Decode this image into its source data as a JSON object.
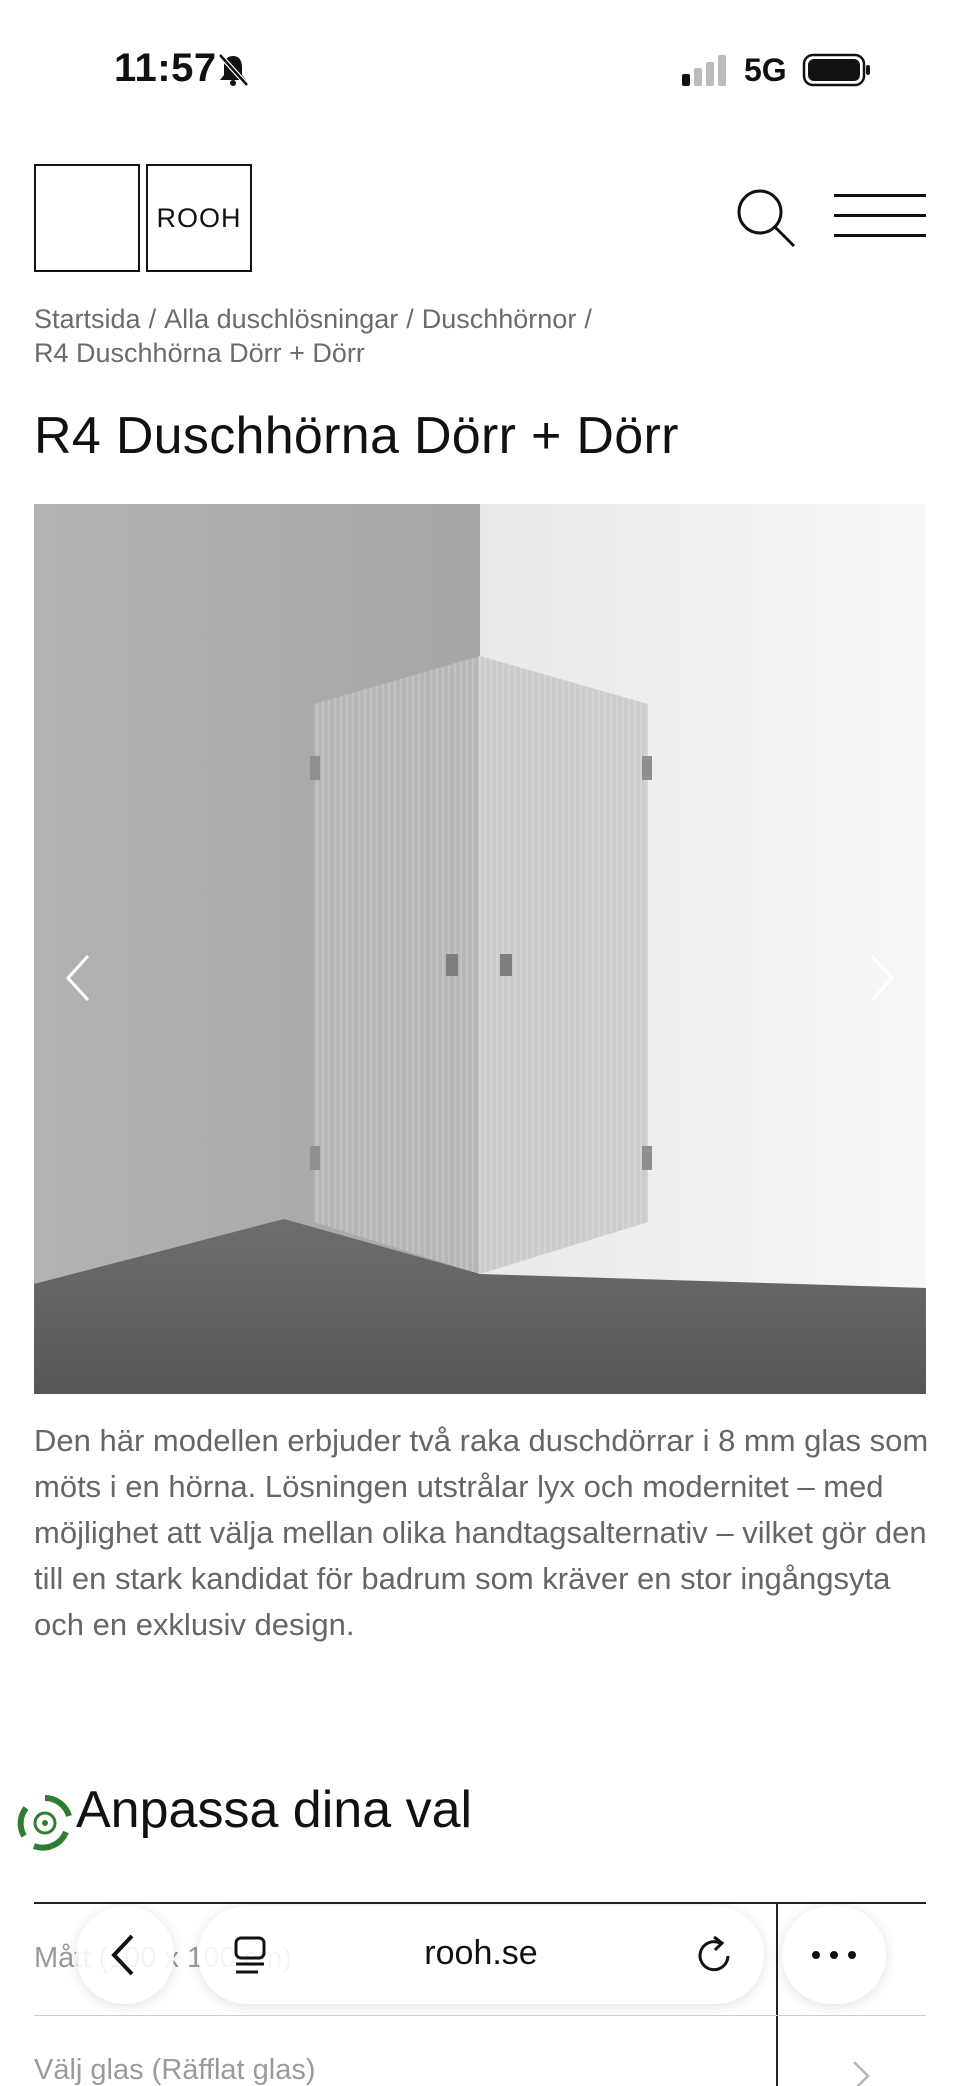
{
  "status_bar": {
    "time": "11:57",
    "network": "5G",
    "icons": [
      "bell-muted-icon",
      "signal-icon",
      "battery-icon"
    ]
  },
  "header": {
    "logo_text": "ROOH",
    "icons": [
      "search-icon",
      "menu-icon"
    ]
  },
  "breadcrumb": {
    "items": [
      "Startsida",
      "Alla duschlösningar",
      "Duschhörnor",
      "R4 Duschhörna Dörr + Dörr"
    ],
    "separator": "/"
  },
  "product": {
    "title": "R4 Duschhörna Dörr + Dörr",
    "description": "Den här modellen erbjuder två raka duschdörrar i 8 mm glas som möts i en hörna. Lösningen utstrålar lyx och modernitet – med möjlighet att välja mellan olika handtagsalternativ – vilket gör den till en stark kandidat för badrum som kräver en stor ingångsyta och en exklusiv design.",
    "gallery_icons": [
      "chevron-left-icon",
      "chevron-right-icon"
    ]
  },
  "customize": {
    "heading": "Anpassa dina val",
    "options": [
      {
        "label": "Mått (100 x 100 cm)"
      },
      {
        "label": "Välj glas (Räfflat glas)"
      }
    ]
  },
  "browser": {
    "url": "rooh.se",
    "icons": [
      "back-icon",
      "tabs-icon",
      "reload-icon",
      "more-icon"
    ]
  },
  "colors": {
    "text": "#111111",
    "muted": "#6b6b6b",
    "eco_green": "#2e7d32"
  }
}
